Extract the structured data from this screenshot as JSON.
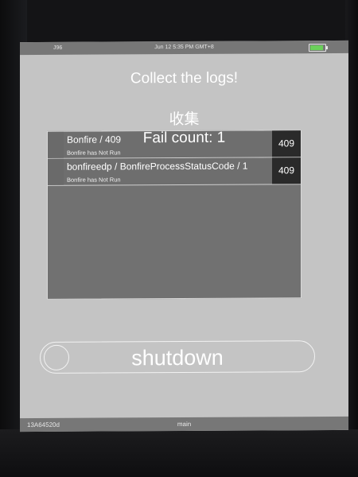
{
  "statusbar": {
    "carrier": "J96",
    "time": "Jun 12 5:35 PM GMT+8"
  },
  "header": {
    "title": "Collect the logs!",
    "subtitle": "收集",
    "fail_count": "Fail count: 1"
  },
  "failures": [
    {
      "name": "Bonfire / 409",
      "status": "Bonfire has Not Run",
      "code": "409"
    },
    {
      "name": "bonfireedp / BonfireProcessStatusCode / 1",
      "status": "Bonfire has Not Run",
      "code": "409"
    }
  ],
  "shutdown": {
    "label": "shutdown"
  },
  "bottombar": {
    "serial": "13A64520d",
    "branch": "main"
  },
  "colors": {
    "screen_bg": "#c4c4c4",
    "bar_bg": "#777777",
    "list_bg": "#717171",
    "code_bg": "#2a2a2a",
    "battery": "#6bd15a"
  }
}
